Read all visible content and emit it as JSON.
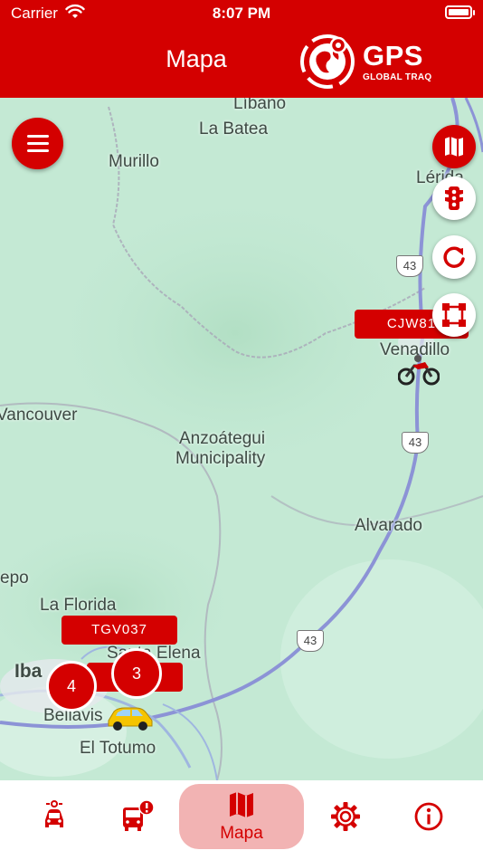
{
  "status_bar": {
    "carrier": "Carrier",
    "time": "8:07 PM"
  },
  "header": {
    "title": "Mapa",
    "logo_text": "GPS",
    "logo_subtext": "GLOBAL TRAQ"
  },
  "map": {
    "places": [
      "Líbano",
      "La Batea",
      "Murillo",
      "Lérida",
      "Venadillo",
      "Vancouver",
      "Anzoátegui",
      "Municipality",
      "Alvarado",
      "epo",
      "La Florida",
      "Santa Elena",
      "Iba",
      "Bellavis",
      "El Totumo"
    ],
    "highway_shields": [
      "43",
      "43",
      "43"
    ],
    "vehicles": [
      {
        "plate": "CJW81",
        "icon": "motorcycle-icon"
      },
      {
        "plate": "TGV037",
        "icon": "taxi-icon"
      },
      {
        "plate": "WT",
        "icon": "taxi-icon"
      }
    ],
    "clusters": [
      {
        "count": "4"
      },
      {
        "count": "3"
      }
    ]
  },
  "side_controls": [
    "map-icon",
    "traffic-light-icon",
    "refresh-icon",
    "fit-bounds-icon"
  ],
  "bottom_nav": {
    "tabs": [
      {
        "icon": "vehicle-icon",
        "label": ""
      },
      {
        "icon": "bus-alert-icon",
        "label": ""
      },
      {
        "icon": "map-icon",
        "label": "Mapa",
        "active": true
      },
      {
        "icon": "gear-icon",
        "label": ""
      },
      {
        "icon": "info-icon",
        "label": ""
      }
    ]
  },
  "colors": {
    "brand": "#d40000",
    "active_tab_bg": "#f2b3b3",
    "map_bg": "#bfe7d1"
  }
}
